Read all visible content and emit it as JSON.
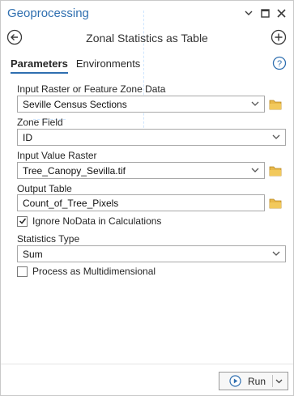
{
  "window": {
    "title": "Geoprocessing",
    "controls": [
      "dropdown-icon",
      "maximize-icon",
      "close-icon"
    ]
  },
  "header": {
    "tool_title": "Zonal Statistics as Table"
  },
  "tabs": [
    {
      "label": "Parameters",
      "active": true
    },
    {
      "label": "Environments",
      "active": false
    }
  ],
  "params": {
    "zone_data": {
      "label": "Input Raster or Feature Zone Data",
      "value": "Seville Census Sections"
    },
    "zone_field": {
      "label": "Zone Field",
      "value": "ID"
    },
    "value_raster": {
      "label": "Input Value Raster",
      "value": "Tree_Canopy_Sevilla.tif"
    },
    "output_table": {
      "label": "Output Table",
      "value": "Count_of_Tree_Pixels"
    },
    "ignore_nodata": {
      "label": "Ignore NoData in Calculations",
      "checked": true
    },
    "statistics_type": {
      "label": "Statistics Type",
      "value": "Sum"
    },
    "multidimensional": {
      "label": "Process as Multidimensional",
      "checked": false
    }
  },
  "footer": {
    "run_label": "Run"
  },
  "colors": {
    "accent": "#2f6fb0",
    "folder": "#d9a326"
  }
}
